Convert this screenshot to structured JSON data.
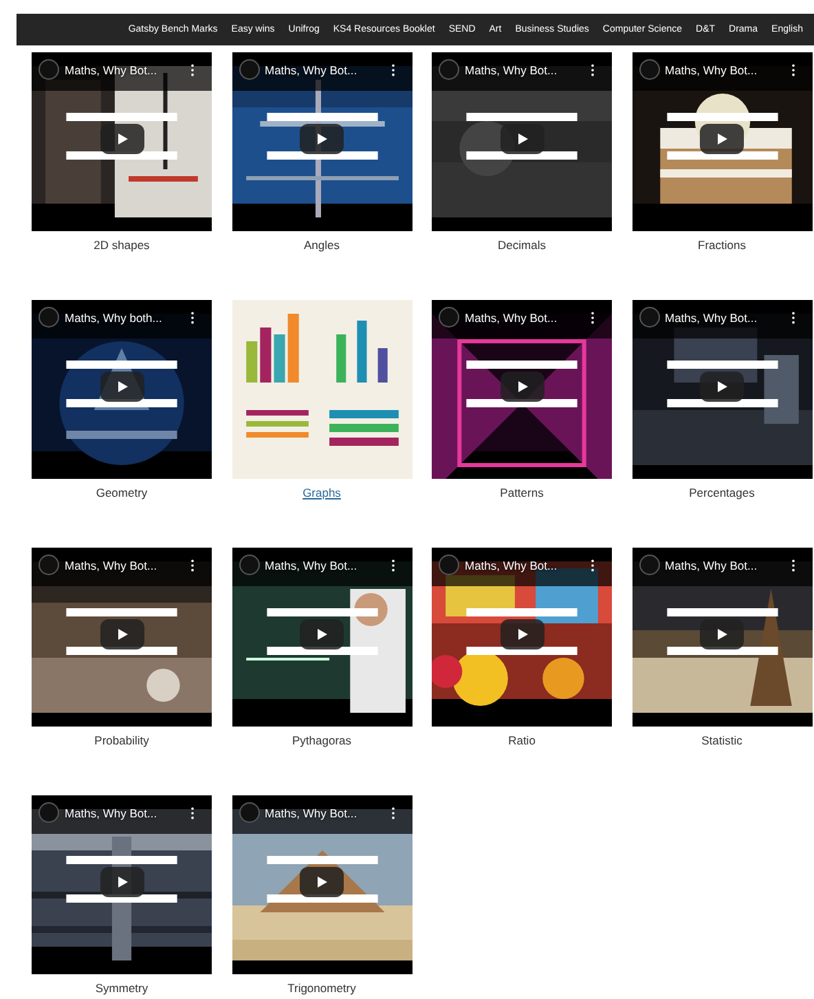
{
  "nav": {
    "items": [
      {
        "label": "Gatsby Bench Marks"
      },
      {
        "label": "Easy wins"
      },
      {
        "label": "Unifrog"
      },
      {
        "label": "KS4 Resources Booklet"
      },
      {
        "label": "SEND"
      },
      {
        "label": "Art"
      },
      {
        "label": "Business Studies"
      },
      {
        "label": "Computer Science"
      },
      {
        "label": "D&T"
      },
      {
        "label": "Drama"
      },
      {
        "label": "English"
      }
    ]
  },
  "tiles": [
    {
      "kind": "video",
      "video_title": "Maths, Why Bot...",
      "caption": "2D shapes",
      "link": false
    },
    {
      "kind": "video",
      "video_title": "Maths, Why Bot...",
      "caption": "Angles",
      "link": false
    },
    {
      "kind": "video",
      "video_title": "Maths, Why Bot...",
      "caption": "Decimals",
      "link": false
    },
    {
      "kind": "video",
      "video_title": "Maths, Why Bot...",
      "caption": "Fractions",
      "link": false
    },
    {
      "kind": "video",
      "video_title": "Maths, Why both...",
      "caption": "Geometry",
      "link": false
    },
    {
      "kind": "picture",
      "caption": "Graphs",
      "link": true
    },
    {
      "kind": "video",
      "video_title": "Maths, Why Bot...",
      "caption": "Patterns",
      "link": false
    },
    {
      "kind": "video",
      "video_title": "Maths, Why Bot...",
      "caption": "Percentages",
      "link": false
    },
    {
      "kind": "video",
      "video_title": "Maths, Why Bot...",
      "caption": "Probability",
      "link": false
    },
    {
      "kind": "video",
      "video_title": "Maths, Why Bot...",
      "caption": "Pythagoras",
      "link": false
    },
    {
      "kind": "video",
      "video_title": "Maths, Why Bot...",
      "caption": "Ratio",
      "link": false
    },
    {
      "kind": "video",
      "video_title": "Maths, Why Bot...",
      "caption": "Statistic",
      "link": false
    },
    {
      "kind": "video",
      "video_title": "Maths, Why Bot...",
      "caption": "Symmetry",
      "link": false
    },
    {
      "kind": "video",
      "video_title": "Maths, Why Bot...",
      "caption": "Trigonometry",
      "link": false
    }
  ]
}
